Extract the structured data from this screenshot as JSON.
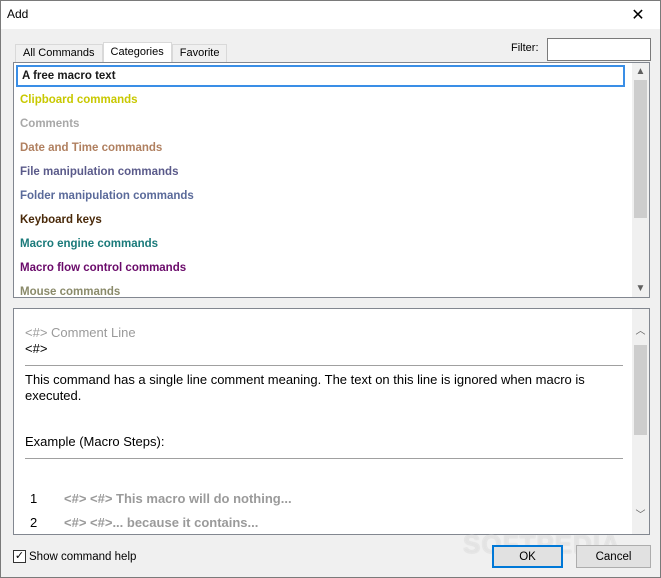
{
  "window": {
    "title": "Add",
    "close_glyph": "✕"
  },
  "tabs": [
    {
      "label": "All Commands"
    },
    {
      "label": "Categories",
      "active": true
    },
    {
      "label": "Favorite"
    }
  ],
  "filter": {
    "label": "Filter:",
    "value": ""
  },
  "list": {
    "items": [
      {
        "label": "A free macro text",
        "color": "#1a1a1a",
        "selected": true
      },
      {
        "label": "Clipboard commands",
        "color": "#c8c800"
      },
      {
        "label": "Comments",
        "color": "#a8a8a8"
      },
      {
        "label": "Date and Time commands",
        "color": "#b08060"
      },
      {
        "label": "File manipulation commands",
        "color": "#5a5a8a"
      },
      {
        "label": "Folder manipulation commands",
        "color": "#5a6a9a"
      },
      {
        "label": "Keyboard keys",
        "color": "#4a2a0a"
      },
      {
        "label": "Macro engine commands",
        "color": "#1a7a7a"
      },
      {
        "label": "Macro flow control commands",
        "color": "#6a0a6a"
      },
      {
        "label": "Mouse commands",
        "color": "#8a8a6a"
      }
    ],
    "scroll_up_glyph": "▲",
    "scroll_down_glyph": "▼"
  },
  "help": {
    "title": "<#> Comment Line",
    "syntax": "<#>",
    "description": "This command has a single line comment meaning. The text on this line is ignored when macro is executed.",
    "example_heading": "Example (Macro Steps):",
    "steps": [
      {
        "num": "1",
        "code": "<#> <#> This macro will do nothing..."
      },
      {
        "num": "2",
        "code": "<#> <#>... because it contains..."
      }
    ],
    "scroll_up_glyph": "︿",
    "scroll_down_glyph": "﹀"
  },
  "footer": {
    "show_help_label": "Show command help",
    "show_help_checked": "✓",
    "ok_label": "OK",
    "cancel_label": "Cancel",
    "watermark": "SOFTPEDIA"
  },
  "colors": {
    "selection_border": "#3a8ee6",
    "default_button_border": "#0078d7"
  }
}
